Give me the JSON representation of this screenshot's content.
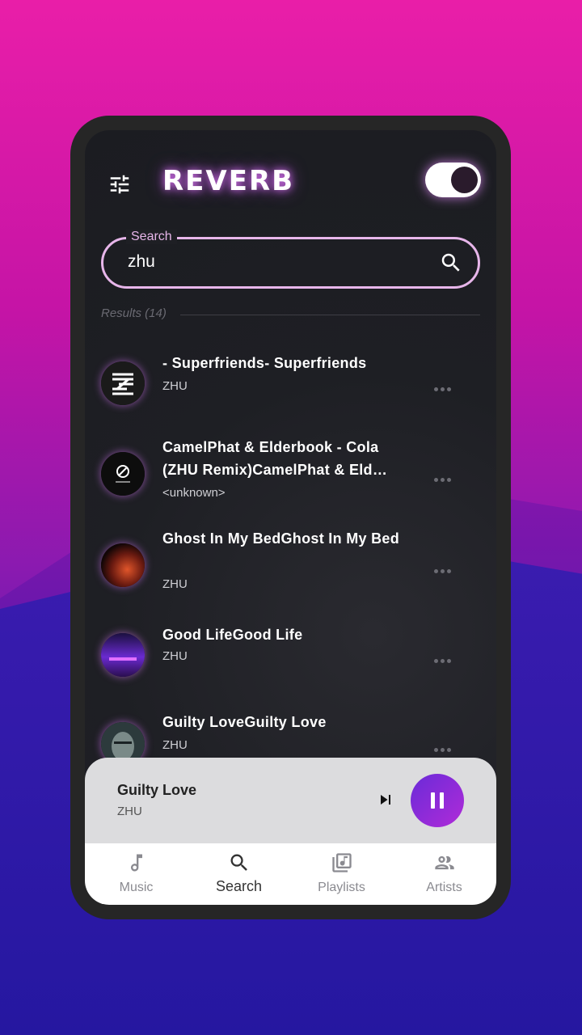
{
  "app": {
    "title": "REVERB"
  },
  "search": {
    "label": "Search",
    "value": "zhu"
  },
  "results": {
    "label": "Results (14)"
  },
  "tracks": [
    {
      "title": "- Superfriends- Superfriends",
      "artist": "ZHU"
    },
    {
      "title": "CamelPhat & Elderbook - Cola (ZHU Remix)CamelPhat & Eld…",
      "artist": "<unknown>"
    },
    {
      "title": "Ghost In My BedGhost In My Bed",
      "artist": "ZHU"
    },
    {
      "title": "Good LifeGood Life",
      "artist": "ZHU"
    },
    {
      "title": "Guilty LoveGuilty Love",
      "artist": "ZHU"
    }
  ],
  "now_playing": {
    "title": "Guilty Love",
    "artist": "ZHU"
  },
  "nav": [
    {
      "label": "Music",
      "icon": "music-note-icon"
    },
    {
      "label": "Search",
      "icon": "search-icon"
    },
    {
      "label": "Playlists",
      "icon": "playlist-icon"
    },
    {
      "label": "Artists",
      "icon": "artists-icon"
    }
  ],
  "colors": {
    "accent": "#e7b6ea",
    "play_button": "#8a2bd8",
    "screen_bg": "#1e1f24"
  }
}
